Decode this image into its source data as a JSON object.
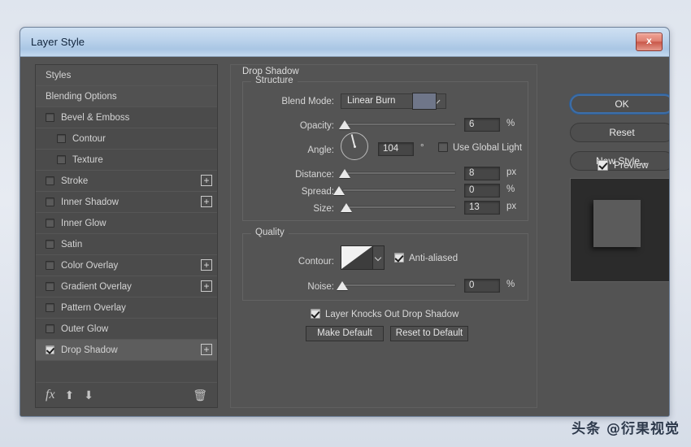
{
  "window": {
    "title": "Layer Style",
    "close_label": "x"
  },
  "styles_list": [
    {
      "label": "Styles",
      "checkbox": null,
      "indent": false,
      "plus": false,
      "selected": false,
      "header": true
    },
    {
      "label": "Blending Options",
      "checkbox": null,
      "indent": false,
      "plus": false,
      "selected": false,
      "header": true
    },
    {
      "label": "Bevel & Emboss",
      "checkbox": false,
      "indent": false,
      "plus": false,
      "selected": false,
      "header": false
    },
    {
      "label": "Contour",
      "checkbox": false,
      "indent": true,
      "plus": false,
      "selected": false,
      "header": false
    },
    {
      "label": "Texture",
      "checkbox": false,
      "indent": true,
      "plus": false,
      "selected": false,
      "header": false
    },
    {
      "label": "Stroke",
      "checkbox": false,
      "indent": false,
      "plus": true,
      "selected": false,
      "header": false
    },
    {
      "label": "Inner Shadow",
      "checkbox": false,
      "indent": false,
      "plus": true,
      "selected": false,
      "header": false
    },
    {
      "label": "Inner Glow",
      "checkbox": false,
      "indent": false,
      "plus": false,
      "selected": false,
      "header": false
    },
    {
      "label": "Satin",
      "checkbox": false,
      "indent": false,
      "plus": false,
      "selected": false,
      "header": false
    },
    {
      "label": "Color Overlay",
      "checkbox": false,
      "indent": false,
      "plus": true,
      "selected": false,
      "header": false
    },
    {
      "label": "Gradient Overlay",
      "checkbox": false,
      "indent": false,
      "plus": true,
      "selected": false,
      "header": false
    },
    {
      "label": "Pattern Overlay",
      "checkbox": false,
      "indent": false,
      "plus": false,
      "selected": false,
      "header": false
    },
    {
      "label": "Outer Glow",
      "checkbox": false,
      "indent": false,
      "plus": false,
      "selected": false,
      "header": false
    },
    {
      "label": "Drop Shadow",
      "checkbox": true,
      "indent": false,
      "plus": true,
      "selected": true,
      "header": false
    }
  ],
  "styles_toolbar": {
    "fx_label": "fx",
    "move_up_label": "⬆",
    "move_down_label": "⬇",
    "delete_label": "🗑"
  },
  "options": {
    "effect_title": "Drop Shadow",
    "structure": {
      "caption": "Structure",
      "blend_mode_label": "Blend Mode:",
      "blend_mode_value": "Linear Burn",
      "color_swatch": "#6f7689",
      "opacity_label": "Opacity:",
      "opacity_value": "6",
      "opacity_unit": "%",
      "angle_label": "Angle:",
      "angle_value": "104",
      "angle_unit": "°",
      "use_global_light_label": "Use Global Light",
      "use_global_light_checked": false,
      "distance_label": "Distance:",
      "distance_value": "8",
      "distance_unit": "px",
      "spread_label": "Spread:",
      "spread_value": "0",
      "spread_unit": "%",
      "size_label": "Size:",
      "size_value": "13",
      "size_unit": "px"
    },
    "quality": {
      "caption": "Quality",
      "contour_label": "Contour:",
      "anti_aliased_label": "Anti-aliased",
      "anti_aliased_checked": true,
      "noise_label": "Noise:",
      "noise_value": "0",
      "noise_unit": "%"
    },
    "knockout_label": "Layer Knocks Out Drop Shadow",
    "knockout_checked": true,
    "make_default_label": "Make Default",
    "reset_to_default_label": "Reset to Default"
  },
  "right": {
    "ok_label": "OK",
    "reset_label": "Reset",
    "new_style_label": "New Style...",
    "preview_label": "Preview",
    "preview_checked": true
  },
  "watermark": "头条 @衍果视觉"
}
